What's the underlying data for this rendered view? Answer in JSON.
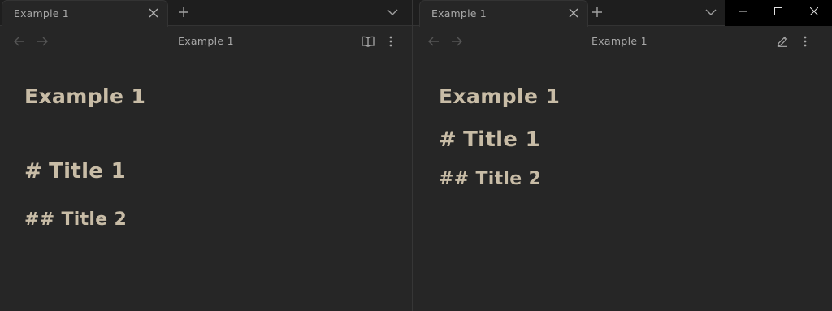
{
  "left_pane": {
    "tab_title": "Example 1",
    "nav_title": "Example 1",
    "doc_title": "Example 1",
    "heading1": {
      "marker": "#",
      "text": "Title 1"
    },
    "heading2": {
      "marker": "##",
      "text": "Title 2"
    },
    "mode_icon": "book-open-icon"
  },
  "right_pane": {
    "tab_title": "Example 1",
    "nav_title": "Example 1",
    "doc_title": "Example 1",
    "heading1": {
      "marker": "#",
      "text": "Title 1"
    },
    "heading2": {
      "marker": "##",
      "text": "Title 2"
    },
    "mode_icon": "pencil-icon"
  },
  "colors": {
    "background": "#262626",
    "tabbar": "#1e1e1e",
    "heading_text": "#c8bca6",
    "ui_text": "#a8a8a8",
    "window_controls": "#000000"
  }
}
